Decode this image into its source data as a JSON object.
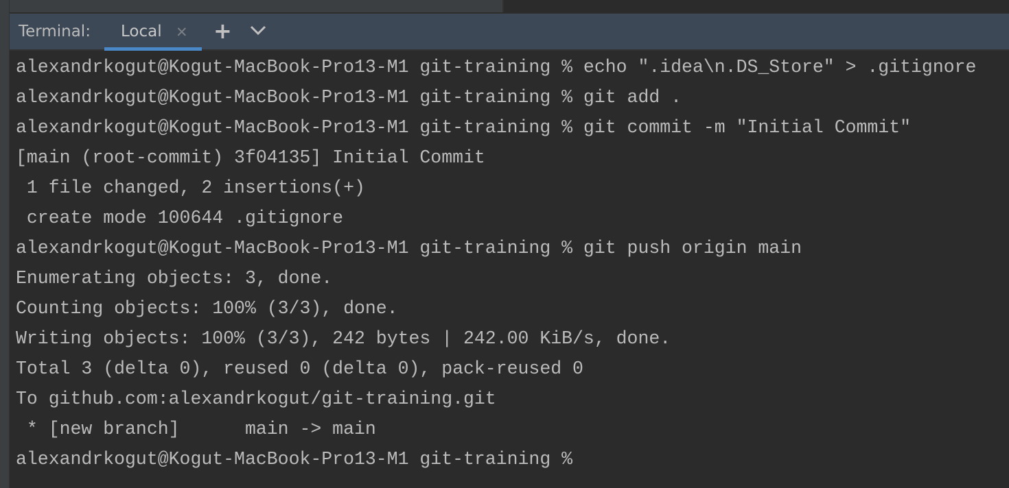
{
  "tabbar": {
    "label": "Terminal:",
    "tabs": [
      {
        "label": "Local",
        "close_icon": "close-icon"
      }
    ],
    "new_tab_icon": "plus-icon",
    "dropdown_icon": "chevron-down-icon"
  },
  "colors": {
    "accent": "#4a88c7",
    "terminal_bg": "#2b2b2b",
    "tabbar_bg": "#3d4856",
    "text": "#bbbbbb"
  },
  "terminal": {
    "lines": [
      "alexandrkogut@Kogut-MacBook-Pro13-M1 git-training % echo \".idea\\n.DS_Store\" > .gitignore",
      "alexandrkogut@Kogut-MacBook-Pro13-M1 git-training % git add .",
      "alexandrkogut@Kogut-MacBook-Pro13-M1 git-training % git commit -m \"Initial Commit\"",
      "[main (root-commit) 3f04135] Initial Commit",
      " 1 file changed, 2 insertions(+)",
      " create mode 100644 .gitignore",
      "alexandrkogut@Kogut-MacBook-Pro13-M1 git-training % git push origin main",
      "Enumerating objects: 3, done.",
      "Counting objects: 100% (3/3), done.",
      "Writing objects: 100% (3/3), 242 bytes | 242.00 KiB/s, done.",
      "Total 3 (delta 0), reused 0 (delta 0), pack-reused 0",
      "To github.com:alexandrkogut/git-training.git",
      " * [new branch]      main -> main",
      "alexandrkogut@Kogut-MacBook-Pro13-M1 git-training % "
    ]
  }
}
